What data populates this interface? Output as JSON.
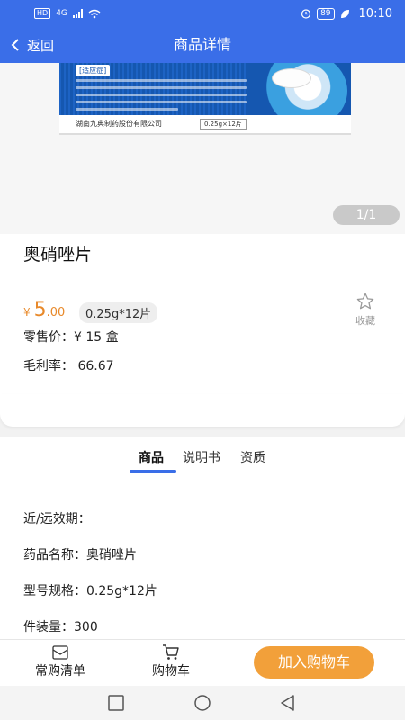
{
  "status_bar": {
    "hd": "HD",
    "network": "4G",
    "battery": "89",
    "time": "10:10"
  },
  "nav": {
    "back_label": "返回",
    "title": "商品详情"
  },
  "hero": {
    "box_tag": "[适应症]",
    "box_company": "湖南九典制药股份有限公司",
    "box_spec": "0.25g×12片",
    "pager": "1/1"
  },
  "product": {
    "name": "奥硝唑片",
    "price_currency": "¥",
    "price_integer": "5",
    "price_decimal": ".00",
    "spec": "0.25g*12片",
    "favorite_label": "收藏",
    "retail_price": "零售价：¥ 15 盒",
    "gross_margin": "毛利率：  66.67"
  },
  "tabs": [
    "商品",
    "说明书",
    "资质"
  ],
  "details": {
    "expiry": "近/远效期：",
    "drug_name": "药品名称：奥硝唑片",
    "model_spec": "型号规格：0.25g*12片",
    "package_qty": "件装量：300"
  },
  "actions": {
    "frequent_list": "常购清单",
    "cart": "购物车",
    "add_to_cart": "加入购物车"
  },
  "colors": {
    "primary": "#3a6ee8",
    "price": "#e8892a",
    "cta": "#f2a03a"
  }
}
